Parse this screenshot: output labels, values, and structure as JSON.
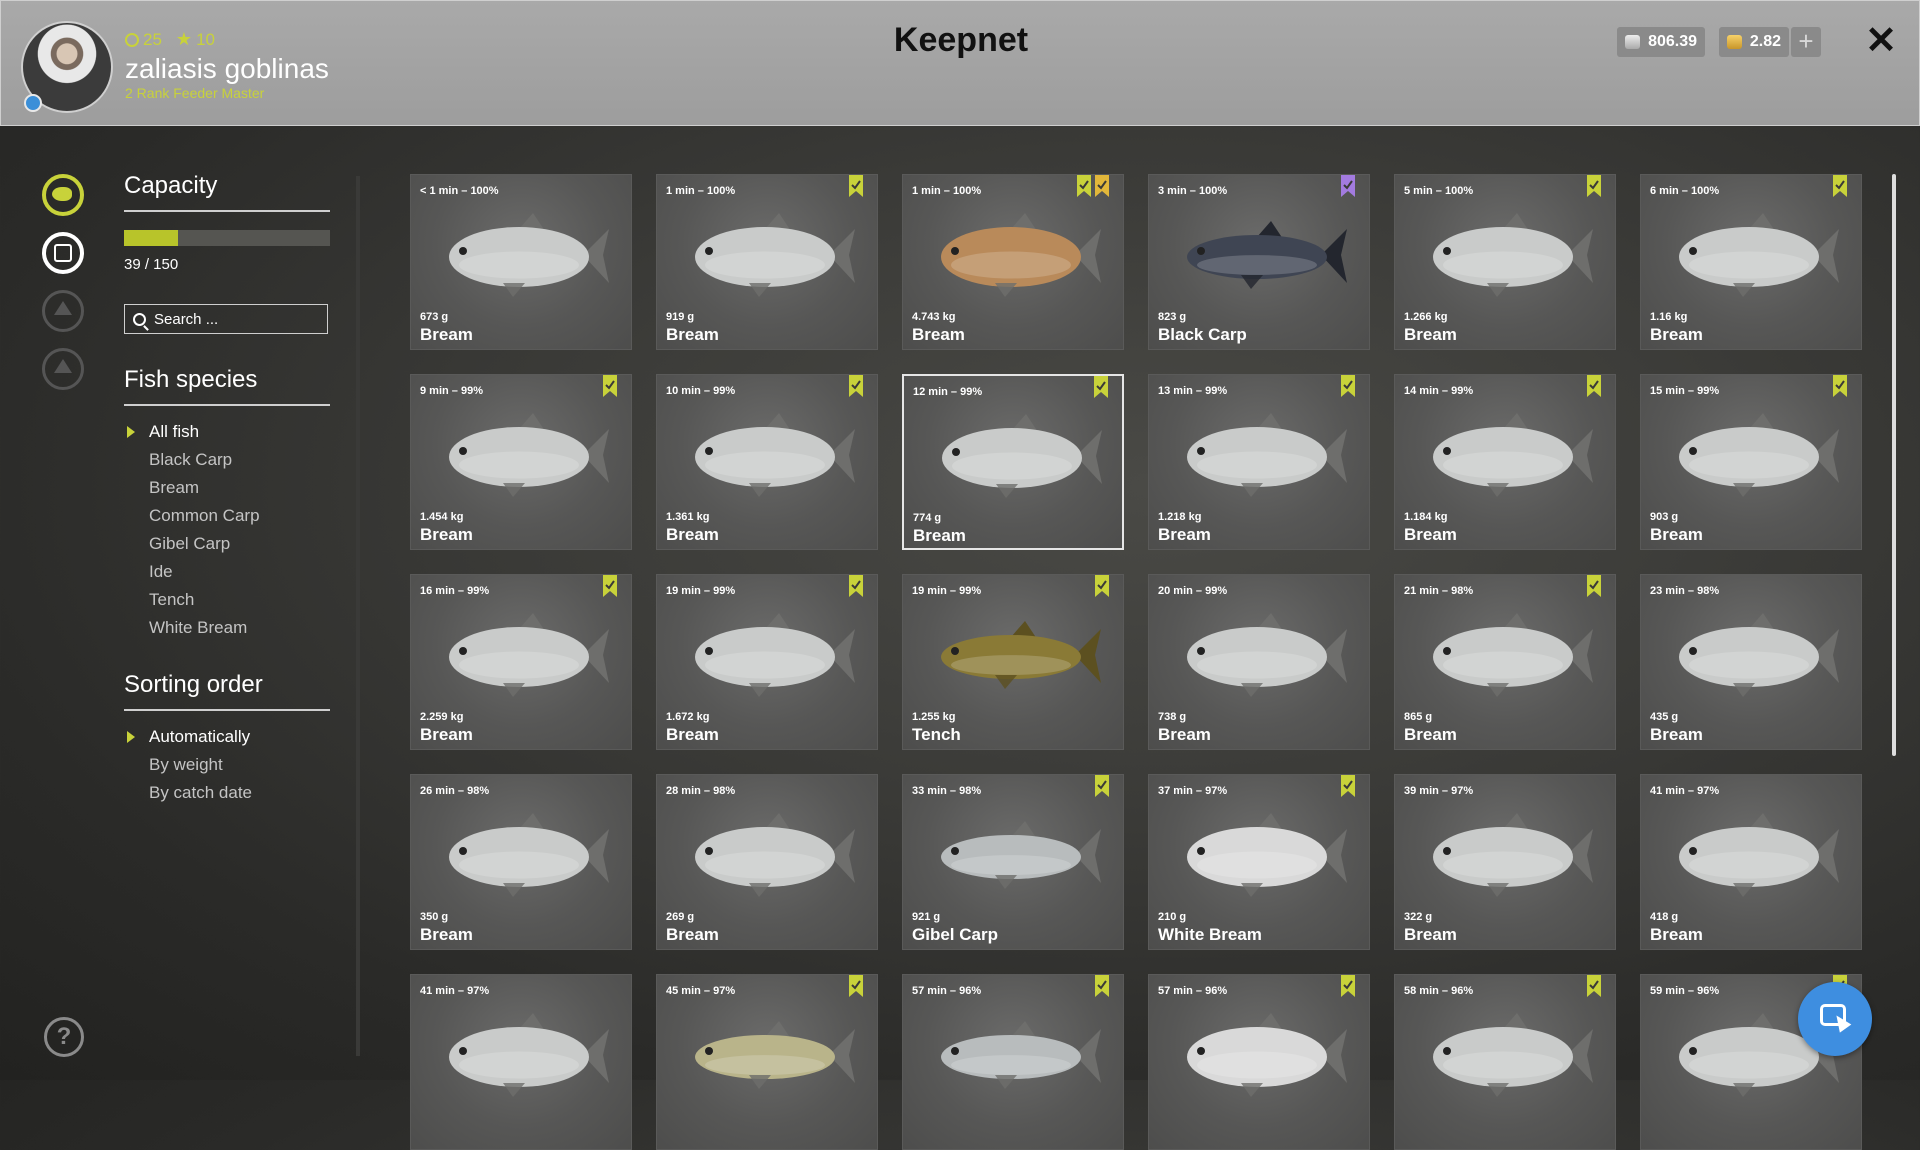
{
  "header": {
    "title": "Keepnet",
    "user": {
      "name": "zaliasis goblinas",
      "rank": "2 Rank Feeder Master",
      "level": "25",
      "stars": "10"
    },
    "currency": {
      "silver": "806.39",
      "gold": "2.82"
    },
    "add_currency_label": "+",
    "close_label": "✕"
  },
  "sidebar": {
    "capacity": {
      "heading": "Capacity",
      "text": "39 / 150",
      "fraction": 0.26
    },
    "search": {
      "placeholder": "Search ..."
    },
    "species": {
      "heading": "Fish species",
      "items": [
        "All fish",
        "Black Carp",
        "Bream",
        "Common Carp",
        "Gibel Carp",
        "Ide",
        "Tench",
        "White Bream"
      ],
      "selected": 0
    },
    "sorting": {
      "heading": "Sorting order",
      "items": [
        "Automatically",
        "By weight",
        "By catch date"
      ],
      "selected": 0
    },
    "help_label": "?"
  },
  "colors": {
    "accent": "#c8d23a",
    "bream": "#c9cbca",
    "black_carp": "#3f4553",
    "tench": "#8a7a36",
    "white_bream": "#d9d9d9",
    "gibel_carp": "#b8bcbd",
    "common_carp": "#b9b48a",
    "bookmark_green": "#c8d23a",
    "bookmark_purple": "#a37be0",
    "bookmark_gold": "#e2b73a"
  },
  "fish": [
    {
      "time": "< 1 min – 100%",
      "weight": "673 g",
      "name": "Bream",
      "color": "bream",
      "badges": []
    },
    {
      "time": "1 min – 100%",
      "weight": "919 g",
      "name": "Bream",
      "color": "bream",
      "badges": [
        "green"
      ]
    },
    {
      "time": "1 min – 100%",
      "weight": "4.743 kg",
      "name": "Bream",
      "color": "golden",
      "badges": [
        "green",
        "gold"
      ]
    },
    {
      "time": "3 min – 100%",
      "weight": "823 g",
      "name": "Black Carp",
      "color": "black_carp",
      "badges": [
        "purple"
      ]
    },
    {
      "time": "5 min – 100%",
      "weight": "1.266 kg",
      "name": "Bream",
      "color": "bream",
      "badges": [
        "green"
      ]
    },
    {
      "time": "6 min – 100%",
      "weight": "1.16 kg",
      "name": "Bream",
      "color": "bream",
      "badges": [
        "green"
      ]
    },
    {
      "time": "9 min – 99%",
      "weight": "1.454 kg",
      "name": "Bream",
      "color": "bream",
      "badges": [
        "green"
      ]
    },
    {
      "time": "10 min – 99%",
      "weight": "1.361 kg",
      "name": "Bream",
      "color": "bream",
      "badges": [
        "green"
      ]
    },
    {
      "time": "12 min – 99%",
      "weight": "774 g",
      "name": "Bream",
      "color": "bream",
      "badges": [
        "green"
      ],
      "selected": true
    },
    {
      "time": "13 min – 99%",
      "weight": "1.218 kg",
      "name": "Bream",
      "color": "bream",
      "badges": [
        "green"
      ]
    },
    {
      "time": "14 min – 99%",
      "weight": "1.184 kg",
      "name": "Bream",
      "color": "bream",
      "badges": [
        "green"
      ]
    },
    {
      "time": "15 min – 99%",
      "weight": "903 g",
      "name": "Bream",
      "color": "bream",
      "badges": [
        "green"
      ]
    },
    {
      "time": "16 min – 99%",
      "weight": "2.259 kg",
      "name": "Bream",
      "color": "bream",
      "badges": [
        "green"
      ]
    },
    {
      "time": "19 min – 99%",
      "weight": "1.672 kg",
      "name": "Bream",
      "color": "bream",
      "badges": [
        "green"
      ]
    },
    {
      "time": "19 min – 99%",
      "weight": "1.255 kg",
      "name": "Tench",
      "color": "tench",
      "badges": [
        "green"
      ]
    },
    {
      "time": "20 min – 99%",
      "weight": "738 g",
      "name": "Bream",
      "color": "bream",
      "badges": []
    },
    {
      "time": "21 min – 98%",
      "weight": "865 g",
      "name": "Bream",
      "color": "bream",
      "badges": [
        "green"
      ]
    },
    {
      "time": "23 min – 98%",
      "weight": "435 g",
      "name": "Bream",
      "color": "bream",
      "badges": []
    },
    {
      "time": "26 min – 98%",
      "weight": "350 g",
      "name": "Bream",
      "color": "bream",
      "badges": []
    },
    {
      "time": "28 min – 98%",
      "weight": "269 g",
      "name": "Bream",
      "color": "bream",
      "badges": []
    },
    {
      "time": "33 min – 98%",
      "weight": "921 g",
      "name": "Gibel Carp",
      "color": "gibel_carp",
      "badges": [
        "green"
      ]
    },
    {
      "time": "37 min – 97%",
      "weight": "210 g",
      "name": "White Bream",
      "color": "white_bream",
      "badges": [
        "green"
      ]
    },
    {
      "time": "39 min – 97%",
      "weight": "322 g",
      "name": "Bream",
      "color": "bream",
      "badges": []
    },
    {
      "time": "41 min – 97%",
      "weight": "418 g",
      "name": "Bream",
      "color": "bream",
      "badges": []
    },
    {
      "time": "41 min – 97%",
      "weight": "",
      "name": "",
      "color": "bream",
      "badges": []
    },
    {
      "time": "45 min – 97%",
      "weight": "",
      "name": "",
      "color": "common_carp",
      "badges": [
        "green"
      ]
    },
    {
      "time": "57 min – 96%",
      "weight": "",
      "name": "",
      "color": "gibel_carp",
      "badges": [
        "green"
      ]
    },
    {
      "time": "57 min – 96%",
      "weight": "",
      "name": "",
      "color": "white_bream",
      "badges": [
        "green"
      ]
    },
    {
      "time": "58 min – 96%",
      "weight": "",
      "name": "",
      "color": "bream",
      "badges": [
        "green"
      ]
    },
    {
      "time": "59 min – 96%",
      "weight": "",
      "name": "",
      "color": "bream",
      "badges": [
        "green"
      ]
    }
  ]
}
